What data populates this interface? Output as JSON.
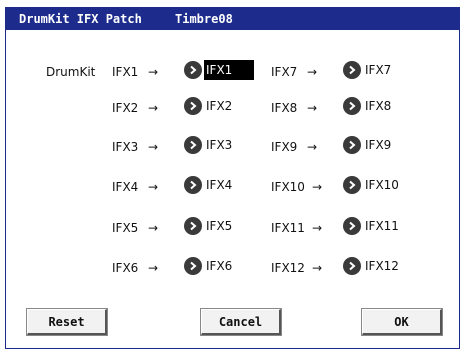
{
  "window": {
    "title_left": "DrumKit IFX Patch",
    "title_right": "Timbre08"
  },
  "row_label": "DrumKit",
  "arrow_glyph": "→",
  "left_column": [
    {
      "label": "IFX1",
      "value": "IFX1",
      "selected": true
    },
    {
      "label": "IFX2",
      "value": "IFX2"
    },
    {
      "label": "IFX3",
      "value": "IFX3"
    },
    {
      "label": "IFX4",
      "value": "IFX4"
    },
    {
      "label": "IFX5",
      "value": "IFX5"
    },
    {
      "label": "IFX6",
      "value": "IFX6"
    }
  ],
  "right_column": [
    {
      "label": "IFX7",
      "value": "IFX7"
    },
    {
      "label": "IFX8",
      "value": "IFX8"
    },
    {
      "label": "IFX9",
      "value": "IFX9"
    },
    {
      "label": "IFX10",
      "value": "IFX10"
    },
    {
      "label": "IFX11",
      "value": "IFX11"
    },
    {
      "label": "IFX12",
      "value": "IFX12"
    }
  ],
  "buttons": {
    "reset": "Reset",
    "cancel": "Cancel",
    "ok": "OK"
  },
  "colors": {
    "titlebar": "#1c2b8c",
    "selection": "#000000",
    "icon": "#3a3a3a"
  },
  "icons": {
    "selector": "chevron-right-circle-icon"
  }
}
